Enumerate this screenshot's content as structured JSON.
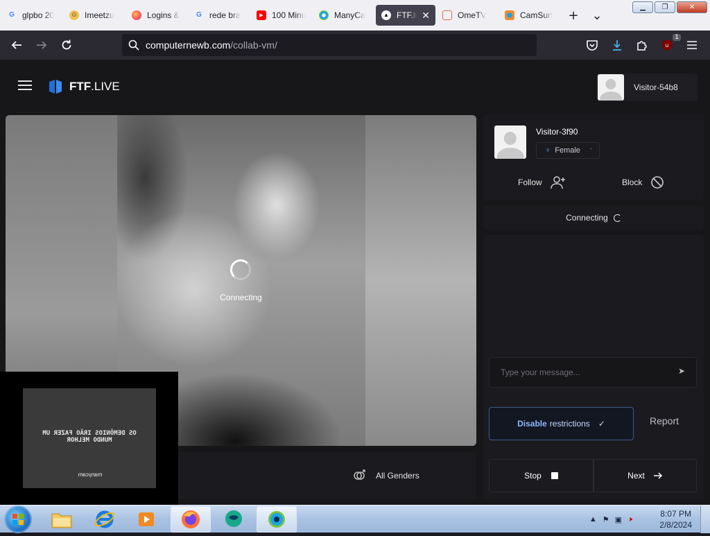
{
  "browser": {
    "tabs": [
      {
        "title": "glpbo 20",
        "icon": "google-icon"
      },
      {
        "title": "Imeetzu",
        "icon": "imeetzu-icon"
      },
      {
        "title": "Logins &",
        "icon": "firefox-icon"
      },
      {
        "title": "rede bra",
        "icon": "google-icon"
      },
      {
        "title": "100 Minu",
        "icon": "youtube-icon"
      },
      {
        "title": "ManyCa",
        "icon": "manycam-icon"
      },
      {
        "title": "FTF.li",
        "icon": "ftf-icon",
        "active": true
      },
      {
        "title": "OmeTV",
        "icon": "ometv-icon"
      },
      {
        "title": "CamSurf",
        "icon": "camsurf-icon"
      }
    ],
    "new_tab": "+",
    "tab_list": "⌄",
    "url": {
      "host": "computernewb.com",
      "path": "/collab-vm/"
    },
    "downloads_badge": "1"
  },
  "site": {
    "logo_bold": "FTF",
    "logo_rest": ".LIVE",
    "current_user": "Visitor-54b8"
  },
  "video": {
    "status": "Connecting",
    "self_cam_text": "OS DEMÔNIOS IRÃO FAZER UM\nMUNDO MELHOR",
    "self_cam_brand": "manycam"
  },
  "filter": {
    "gender_label": "All Genders"
  },
  "partner": {
    "name": "Visitor-3f90",
    "gender": "Female",
    "follow_label": "Follow",
    "block_label": "Block"
  },
  "chat": {
    "status": "Connecting",
    "placeholder": "Type your message..."
  },
  "controls": {
    "disable_bold": "Disable",
    "disable_rest": "restrictions",
    "report_label": "Report",
    "stop_label": "Stop",
    "next_label": "Next"
  },
  "taskbar": {
    "time": "8:07 PM",
    "date": "2/8/2024"
  },
  "colors": {
    "page_bg": "#17171a",
    "panel_bg": "#1b1b1f",
    "accent_border": "#3e5a8a",
    "gender_icon": "#6aa0ff"
  }
}
